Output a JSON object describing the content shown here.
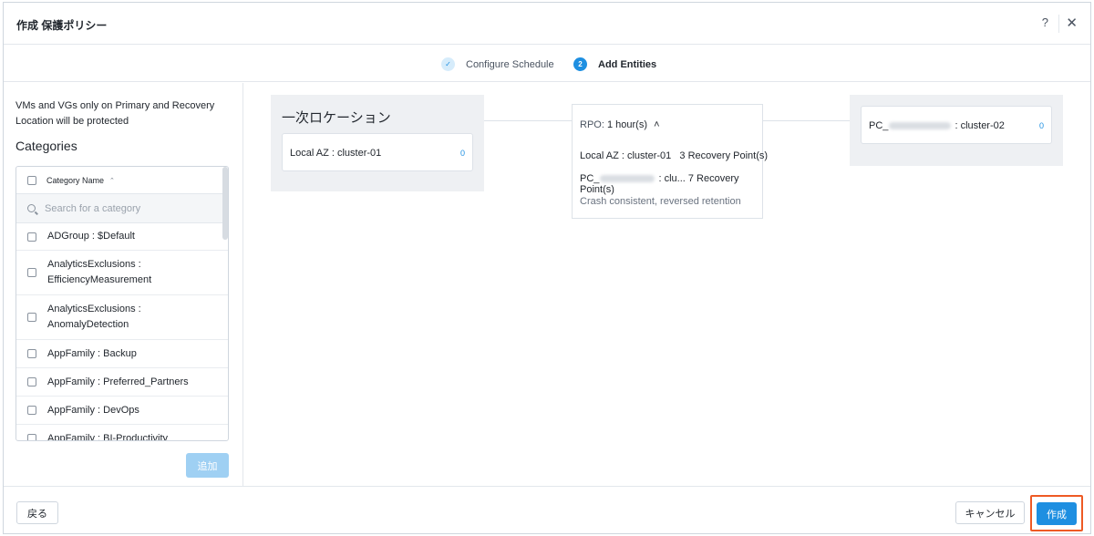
{
  "header": {
    "title": "作成 保護ポリシー",
    "help_label": "?",
    "close_label": "✕"
  },
  "steps": [
    {
      "label": "Configure Schedule",
      "marker": "✓",
      "state": "done"
    },
    {
      "label": "Add Entities",
      "marker": "2",
      "state": "active"
    }
  ],
  "left_panel": {
    "note": "VMs and VGs only on Primary and Recovery Location will be protected",
    "categories_title": "Categories",
    "column_header": "Category Name",
    "sort_icon": "⌃",
    "search_placeholder": "Search for a category",
    "items": [
      "ADGroup : $Default",
      "AnalyticsExclusions : EfficiencyMeasurement",
      "AnalyticsExclusions : AnomalyDetection",
      "AppFamily : Backup",
      "AppFamily : Preferred_Partners",
      "AppFamily : DevOps",
      "AppFamily : BI-Productivity"
    ],
    "add_button": "追加"
  },
  "primary_location": {
    "title": "一次ロケーション",
    "card_label": "Local AZ : cluster-01",
    "card_count": "0"
  },
  "rpo": {
    "label": "RPO:",
    "value": "1 hour(s)",
    "caret": "˄",
    "local_row": "Local AZ : cluster-01   3 Recovery Point(s)",
    "remote_prefix": "PC_",
    "remote_suffix": " : clu... 7 Recovery Point(s)",
    "note": "Crash consistent, reversed retention"
  },
  "recovery_location": {
    "card_prefix": "PC_",
    "card_suffix": " : cluster-02",
    "card_count": "0"
  },
  "footer": {
    "back_button": "戻る",
    "cancel_button": "キャンセル",
    "create_button": "作成"
  },
  "colors": {
    "accent": "#1e8fe1",
    "highlight": "#ee5a24"
  }
}
